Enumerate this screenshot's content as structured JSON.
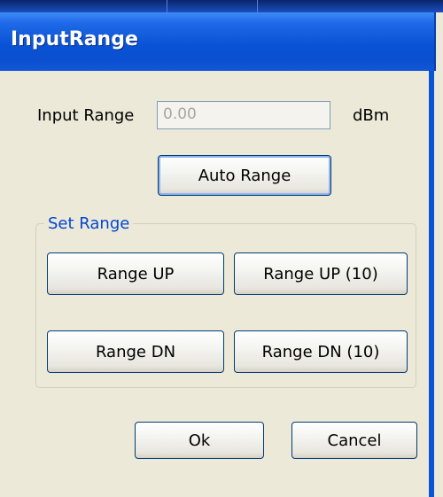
{
  "window": {
    "title": "InputRange"
  },
  "input_range": {
    "label": "Input Range",
    "value": "0.00",
    "unit": "dBm"
  },
  "buttons": {
    "auto_range": "Auto Range",
    "range_up": "Range UP",
    "range_up_10": "Range UP (10)",
    "range_dn": "Range DN",
    "range_dn_10": "Range DN (10)",
    "ok": "Ok",
    "cancel": "Cancel"
  },
  "set_range_group": {
    "label": "Set Range"
  },
  "colors": {
    "titlebar": "#0a53d6",
    "group_label": "#0046d5",
    "dialog_bg": "#ece9d8"
  }
}
